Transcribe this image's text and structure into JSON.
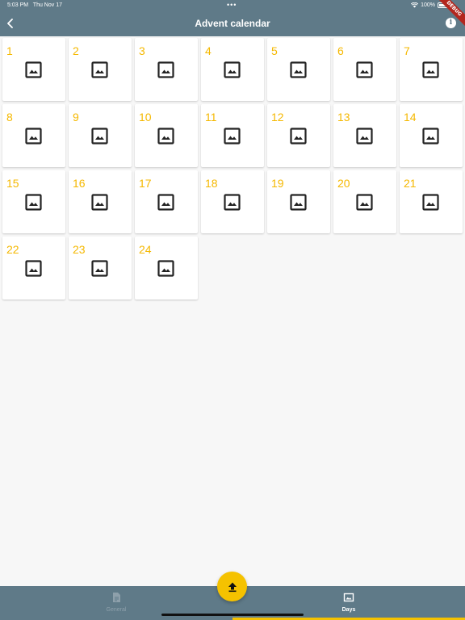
{
  "status_bar": {
    "time": "5:03 PM",
    "date": "Thu Nov 17",
    "dots": "•••",
    "battery": "100%",
    "debug_label": "DEBUG"
  },
  "app_bar": {
    "title": "Advent calendar",
    "back_icon": "chevron-left-icon",
    "info_icon": "info-icon",
    "info_glyph": "i"
  },
  "days": [
    "1",
    "2",
    "3",
    "4",
    "5",
    "6",
    "7",
    "8",
    "9",
    "10",
    "11",
    "12",
    "13",
    "14",
    "15",
    "16",
    "17",
    "18",
    "19",
    "20",
    "21",
    "22",
    "23",
    "24"
  ],
  "day_icon": "image-icon",
  "fab": {
    "icon": "upload-icon"
  },
  "bottom_nav": {
    "items": [
      {
        "label": "General",
        "icon": "document-icon",
        "selected": false
      },
      {
        "label": "Days",
        "icon": "image-icon",
        "selected": true
      }
    ]
  },
  "colors": {
    "app_bar": "#5f7a88",
    "accent": "#f5c200",
    "day_number": "#f5b800",
    "background": "#f7f7f7"
  }
}
